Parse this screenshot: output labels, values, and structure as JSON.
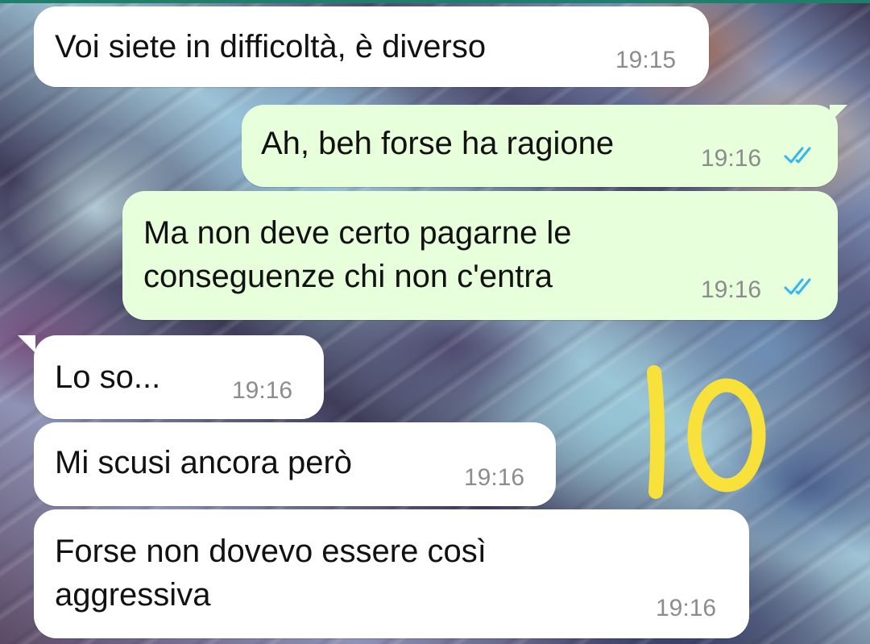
{
  "messages": [
    {
      "direction": "incoming",
      "text": "Voi siete in difficoltà, è diverso",
      "time": "19:15"
    },
    {
      "direction": "outgoing",
      "text": "Ah, beh forse ha ragione",
      "time": "19:16",
      "status": "read"
    },
    {
      "direction": "outgoing",
      "line1": "Ma non deve certo pagarne le",
      "line2": "conseguenze chi non c'entra",
      "time": "19:16",
      "status": "read"
    },
    {
      "direction": "incoming",
      "text": "Lo so...",
      "time": "19:16"
    },
    {
      "direction": "incoming",
      "text": "Mi scusi ancora però",
      "time": "19:16"
    },
    {
      "direction": "incoming",
      "line1": "Forse non dovevo essere così",
      "line2": "aggressiva",
      "time": "19:16"
    }
  ],
  "annotation": {
    "text": "10",
    "color": "#f7e13a"
  },
  "colors": {
    "incoming_bubble": "#ffffff",
    "outgoing_bubble": "#e7ffdb",
    "read_ticks": "#34b7f1",
    "timestamp": "#8c8c8c"
  },
  "icons": {
    "read_receipt": "double-check-icon"
  }
}
